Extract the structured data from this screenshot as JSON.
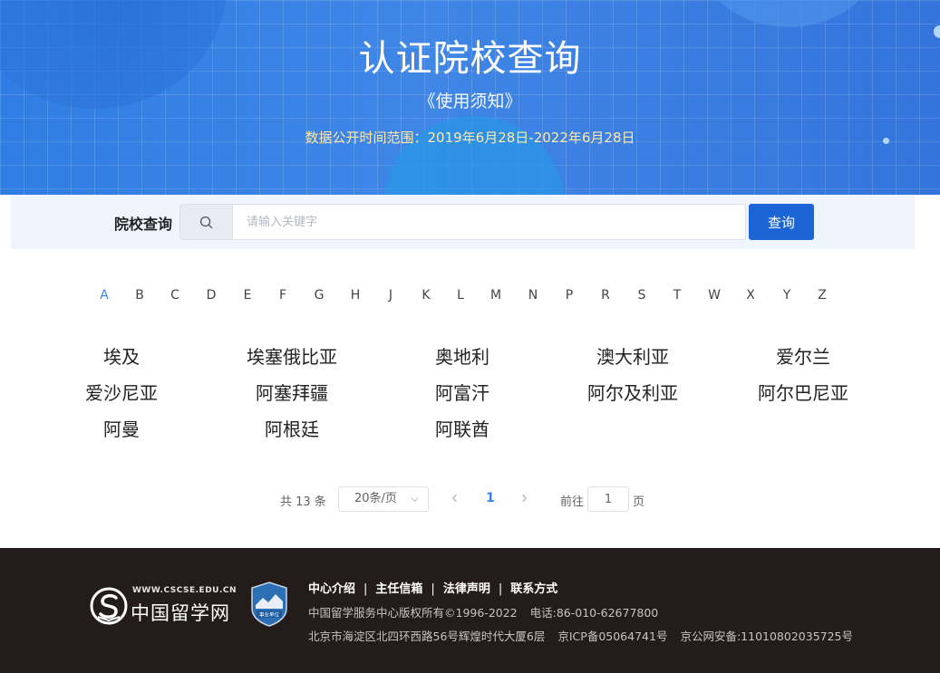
{
  "hero": {
    "title": "认证院校查询",
    "notice_link": "《使用须知》",
    "date_range": "数据公开时间范围：2019年6月28日-2022年6月28日"
  },
  "search": {
    "label": "院校查询",
    "placeholder": "请输入关键字",
    "value": "",
    "button": "查询",
    "icon": "search-icon"
  },
  "alphabet": {
    "active": "A",
    "letters": [
      "A",
      "B",
      "C",
      "D",
      "E",
      "F",
      "G",
      "H",
      "J",
      "K",
      "L",
      "M",
      "N",
      "P",
      "R",
      "S",
      "T",
      "W",
      "X",
      "Y",
      "Z"
    ]
  },
  "countries": [
    "埃及",
    "埃塞俄比亚",
    "奥地利",
    "澳大利亚",
    "爱尔兰",
    "爱沙尼亚",
    "阿塞拜疆",
    "阿富汗",
    "阿尔及利亚",
    "阿尔巴尼亚",
    "阿曼",
    "阿根廷",
    "阿联酋"
  ],
  "pagination": {
    "total": "共 13 条",
    "page_size": "20条/页",
    "current_page": "1",
    "goto_prefix": "前往",
    "goto_value": "1",
    "goto_suffix": "页"
  },
  "footer": {
    "logo_domain": "WWW.CSCSE.EDU.CN",
    "logo_name": "中国留学网",
    "badge_text": "事业单位",
    "links": [
      "中心介绍",
      "主任信箱",
      "法律声明",
      "联系方式"
    ],
    "separator": "|",
    "copyright": "中国留学服务中心版权所有©1996-2022",
    "phone": "电话:86-010-62677800",
    "address": "北京市海淀区北四环西路56号辉煌时代大厦6层",
    "icp": "京ICP备05064741号",
    "police": "京公网安备:11010802035725号"
  },
  "colors": {
    "hero_blue": "#3f86e6",
    "accent": "#3b82e6",
    "button": "#1b65d6",
    "footer_bg": "#231c1a",
    "date_text": "#ffe8a8"
  }
}
